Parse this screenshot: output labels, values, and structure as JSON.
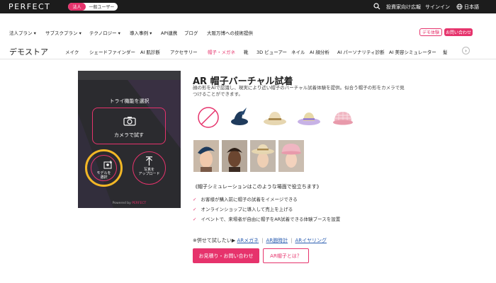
{
  "topbar": {
    "logo": "PERFECT",
    "segment_active": "法人",
    "segment_inactive": "一般ユーザー",
    "links": [
      "投資家向け広報",
      "サインイン",
      "日本語"
    ]
  },
  "nav": {
    "items": [
      "法人プラン ▾",
      "サブスクプラン ▾",
      "テクノロジー ▾",
      "導入事例 ▾",
      "API連携",
      "ブログ",
      "大阪万博への技術提供"
    ],
    "demo_button": "デモ体験",
    "contact_button": "お問い合わせ"
  },
  "store": {
    "title": "デモストア",
    "categories": [
      "メイク",
      "シェードファインダー",
      "AI 肌診断",
      "アクセサリー",
      "帽子・メガネ",
      "靴",
      "3D ビューアー",
      "ネイル",
      "AI 顔分析",
      "AI パーソナリティ診断",
      "AI 美容シミュレーター",
      "髪"
    ]
  },
  "panel": {
    "title": "トライ機能を選択",
    "camera_label": "カメラで試す",
    "select_model_label_1": "モデルを",
    "select_model_label_2": "選択",
    "upload_label_1": "写真を",
    "upload_label_2": "アップロード",
    "powered_prefix": "Powered by",
    "powered_brand": "PERFECT"
  },
  "product": {
    "title": "AR 帽子バーチャル試着",
    "description": "顔の形をAIで認識し、現実により近い帽子のバーチャル試着体験を提供。似合う帽子の形をカメラで見つけることができます。",
    "usecase_heading": "《帽子シミュレーションはこのような場面で役立ちます》",
    "bullets": [
      "お客様が購入前に帽子の試着をイメージできる",
      "オンラインショップに導入して売上を上げる",
      "イベントで、来場者が自由に帽子をAR試着できる体験ブースを設置"
    ],
    "try_prefix": "※併せて試したい▶",
    "try_links": [
      "ARメガネ",
      "AR腕時計",
      "ARイヤリング"
    ],
    "quote_button": "お見積り・お問い合わせ",
    "what_button": "AR帽子とは？"
  },
  "colors": {
    "accent": "#e6336c",
    "dark_panel": "#2b2b2f",
    "highlight_ring": "#f2b726"
  }
}
